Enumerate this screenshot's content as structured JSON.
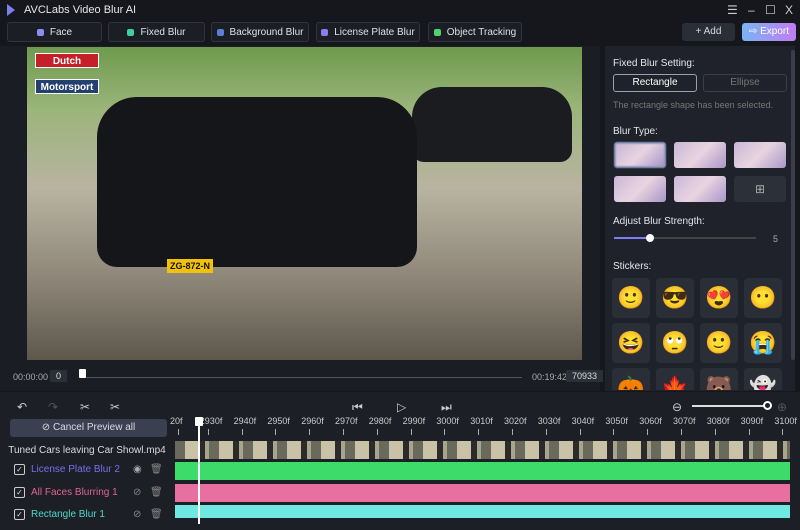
{
  "app": {
    "title": "AVCLabs Video Blur AI"
  },
  "window": {
    "menu": "☰",
    "minimize": "–",
    "maximize": "☐",
    "close": "X"
  },
  "toolbar": {
    "tabs": [
      {
        "label": "Face",
        "color": "#8a8ef0"
      },
      {
        "label": "Fixed Blur",
        "color": "#3fcf9a"
      },
      {
        "label": "Background Blur",
        "color": "#5b7fd6"
      },
      {
        "label": "License Plate Blur",
        "color": "#8a7bf0"
      },
      {
        "label": "Object Tracking",
        "color": "#4fd36a"
      }
    ],
    "add_label": "+ Add",
    "export_label": "⇨ Export"
  },
  "video": {
    "badge_top": "Dutch",
    "badge_bottom": "Motorsport",
    "plate": "ZG-872-N"
  },
  "seek": {
    "start_time": "00:00:00",
    "current_frame": "0",
    "end_time": "00:19:42",
    "total_frames": "70933"
  },
  "panel": {
    "fixed_blur_title": "Fixed Blur Setting:",
    "shapes": [
      "Rectangle",
      "Ellipse"
    ],
    "selected_shape": "Rectangle",
    "shape_note": "The rectangle shape has been selected.",
    "blur_type_title": "Blur Type:",
    "strength_title": "Adjust Blur Strength:",
    "strength_value": "5",
    "strength_max": 20,
    "stickers_title": "Stickers:",
    "stickers": [
      "🙂",
      "😎",
      "😍",
      "😶",
      "😆",
      "🙄",
      "🙂",
      "😭",
      "🎃",
      "🍁",
      "🐻",
      "👻"
    ]
  },
  "timeline": {
    "cancel_preview_label": "Cancel Preview all",
    "ruler": [
      "20f",
      "2930f",
      "2940f",
      "2950f",
      "2960f",
      "2970f",
      "2980f",
      "2990f",
      "3000f",
      "3010f",
      "3020f",
      "3030f",
      "3040f",
      "3050f",
      "3060f",
      "3070f",
      "3080f",
      "3090f",
      "3100f"
    ],
    "video_file": "Tuned Cars leaving Car Showl.mp4",
    "tracks": [
      {
        "label": "License Plate Blur 2",
        "label_color": "#7b6cf0",
        "bar_color": "#3ddc6a",
        "visible": true
      },
      {
        "label": "All Faces Blurring 1",
        "label_color": "#e0668e",
        "bar_color": "#e870a0",
        "visible": false
      },
      {
        "label": "Rectangle Blur 1",
        "label_color": "#4fd8c8",
        "bar_color": "#6ee8e0",
        "visible": false
      }
    ]
  }
}
